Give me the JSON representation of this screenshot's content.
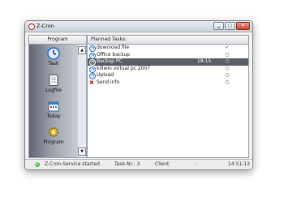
{
  "window": {
    "title": "Z-Cron",
    "controls": {
      "minimize": "▁",
      "maximize": "□",
      "close": "✕"
    }
  },
  "sidebar": {
    "header": "Program",
    "items": [
      {
        "label": "Task",
        "icon": "clock-icon"
      },
      {
        "label": "Logfile",
        "icon": "document-icon"
      },
      {
        "label": "Today",
        "icon": "calendar-icon"
      },
      {
        "label": "Program",
        "icon": "gear-icon"
      }
    ],
    "scroll_up": "▲",
    "scroll_down": "▼"
  },
  "tasks": {
    "header": "Planned Tasks:",
    "rows": [
      {
        "name": "download file",
        "time": "",
        "status": "✓",
        "icon": "clock-icon"
      },
      {
        "name": "Office backup",
        "time": "",
        "status": "○",
        "icon": "clock-icon"
      },
      {
        "name": "Backup PC",
        "time": "18:15",
        "status": "○",
        "icon": "clock-icon",
        "selected": true
      },
      {
        "name": "killwin virtual pc 2007",
        "time": "",
        "status": "○",
        "icon": "clock-icon"
      },
      {
        "name": "Upload",
        "time": "",
        "status": "○",
        "icon": "clock-icon"
      },
      {
        "name": "Send info",
        "time": "",
        "status": "○",
        "icon": "error-icon"
      }
    ]
  },
  "statusbar": {
    "service": "Z-Cron-Service started",
    "task_nr": "Task-Nr.: 3",
    "client": "Client",
    "separator": "-",
    "time": "14:51:13"
  },
  "colors": {
    "selection": "#5a5e66",
    "status_led": "#1a9d1a",
    "clock_icon": "#2f6fd0",
    "error_icon": "#cc2222"
  }
}
